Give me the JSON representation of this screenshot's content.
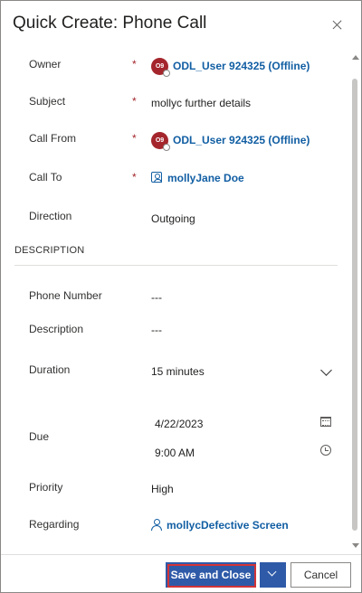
{
  "dialog": {
    "title": "Quick Create: Phone Call",
    "close_icon": "close-icon"
  },
  "fields": {
    "owner": {
      "label": "Owner",
      "required_marker": "*",
      "avatar_initials": "O9",
      "value": "ODL_User 924325 (Offline)"
    },
    "subject": {
      "label": "Subject",
      "required_marker": "*",
      "value": "mollyc further details"
    },
    "call_from": {
      "label": "Call From",
      "required_marker": "*",
      "avatar_initials": "O9",
      "value": "ODL_User 924325 (Offline)"
    },
    "call_to": {
      "label": "Call To",
      "required_marker": "*",
      "icon": "contact-card-icon",
      "value": "mollyJane Doe"
    },
    "direction": {
      "label": "Direction",
      "value": "Outgoing"
    }
  },
  "description_section": {
    "title": "DESCRIPTION",
    "phone_number": {
      "label": "Phone Number",
      "value": "---"
    },
    "description": {
      "label": "Description",
      "value": "---"
    },
    "duration": {
      "label": "Duration",
      "value": "15 minutes",
      "icon": "chevron-down-icon"
    },
    "due": {
      "label": "Due",
      "date": "4/22/2023",
      "time": "9:00 AM",
      "date_icon": "calendar-icon",
      "time_icon": "clock-icon"
    },
    "priority": {
      "label": "Priority",
      "value": "High"
    },
    "regarding": {
      "label": "Regarding",
      "icon": "person-icon",
      "value": "mollycDefective Screen"
    }
  },
  "footer": {
    "save_close_label": "Save and Close",
    "split_icon": "chevron-down-icon",
    "cancel_label": "Cancel"
  },
  "colors": {
    "accent": "#2f5aa8",
    "link": "#115ea3",
    "required": "#a4262c",
    "highlight": "#d13438"
  }
}
